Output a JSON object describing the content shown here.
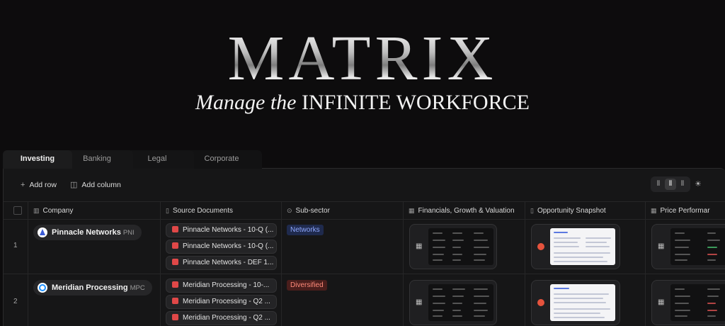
{
  "hero": {
    "title": "MATRIX",
    "subtitle_italic": "Manage the",
    "subtitle_caps": "INFINITE WORKFORCE"
  },
  "tabs": [
    "Investing",
    "Banking",
    "Legal",
    "Corporate"
  ],
  "toolbar": {
    "add_row": "Add row",
    "add_column": "Add column"
  },
  "columns": [
    "Company",
    "Source Documents",
    "Sub-sector",
    "Financials, Growth & Valuation",
    "Opportunity Snapshot",
    "Price Performar"
  ],
  "rows": [
    {
      "num": "1",
      "company": "Pinnacle Networks",
      "ticker": "PNI",
      "docs": [
        "Pinnacle Networks - 10-Q (...",
        "Pinnacle Networks - 10-Q (...",
        "Pinnacle Networks - DEF 1..."
      ],
      "subsector": "Networks"
    },
    {
      "num": "2",
      "company": "Meridian Processing",
      "ticker": "MPC",
      "docs": [
        "Meridian Processing - 10-...",
        "Meridian Processing - Q2 ...",
        "Meridian Processing - Q2 ..."
      ],
      "subsector": "Diversified"
    }
  ],
  "colors": {
    "background": "#0d0c0d",
    "panel": "#161617",
    "tag_blue_text": "#8fa8ff",
    "tag_red_text": "#ff8a7a",
    "pdf_red": "#e04848"
  }
}
